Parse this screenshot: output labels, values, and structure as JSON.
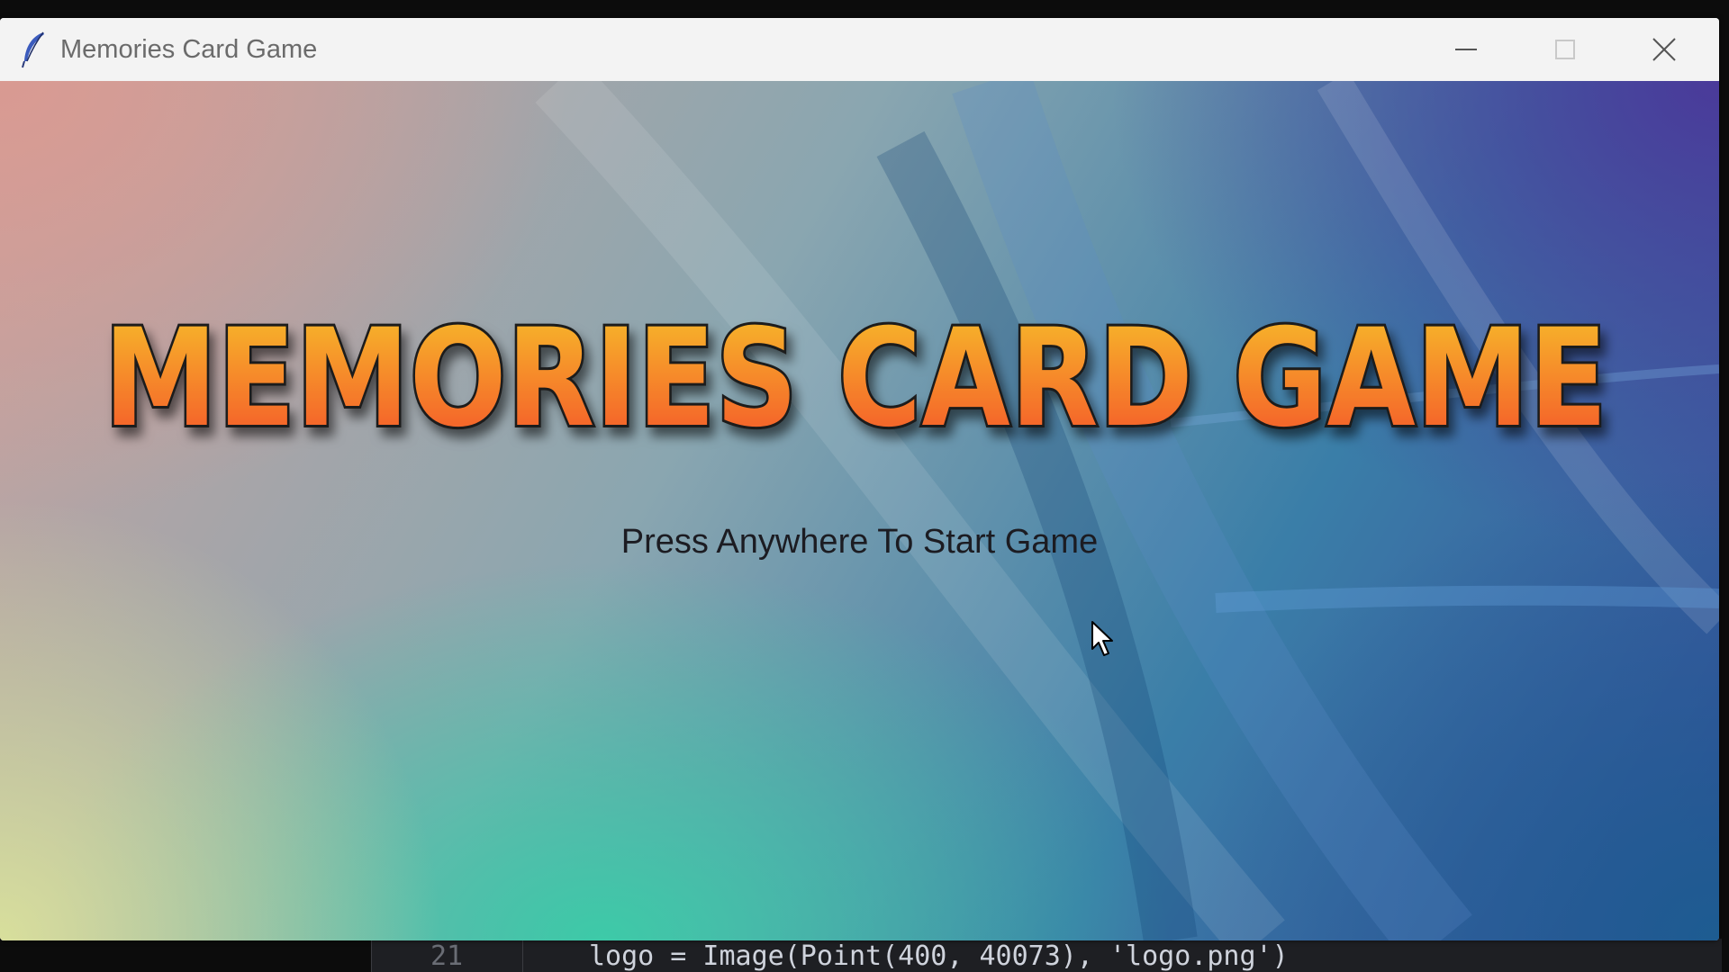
{
  "window": {
    "title": "Memories Card Game",
    "controls": {
      "minimize": "minimize-icon",
      "maximize": "maximize-icon",
      "close": "close-icon"
    }
  },
  "game": {
    "logo_text": "MEMORIES CARD GAME",
    "start_prompt": "Press Anywhere To Start Game"
  },
  "background_editor": {
    "line_number": "21",
    "code_line": "logo = Image(Point(400, 40073), 'logo.png')"
  },
  "colors": {
    "logo_top": "#f7c02a",
    "logo_bottom": "#f4502a",
    "logo_outline": "#1a1a1a"
  }
}
